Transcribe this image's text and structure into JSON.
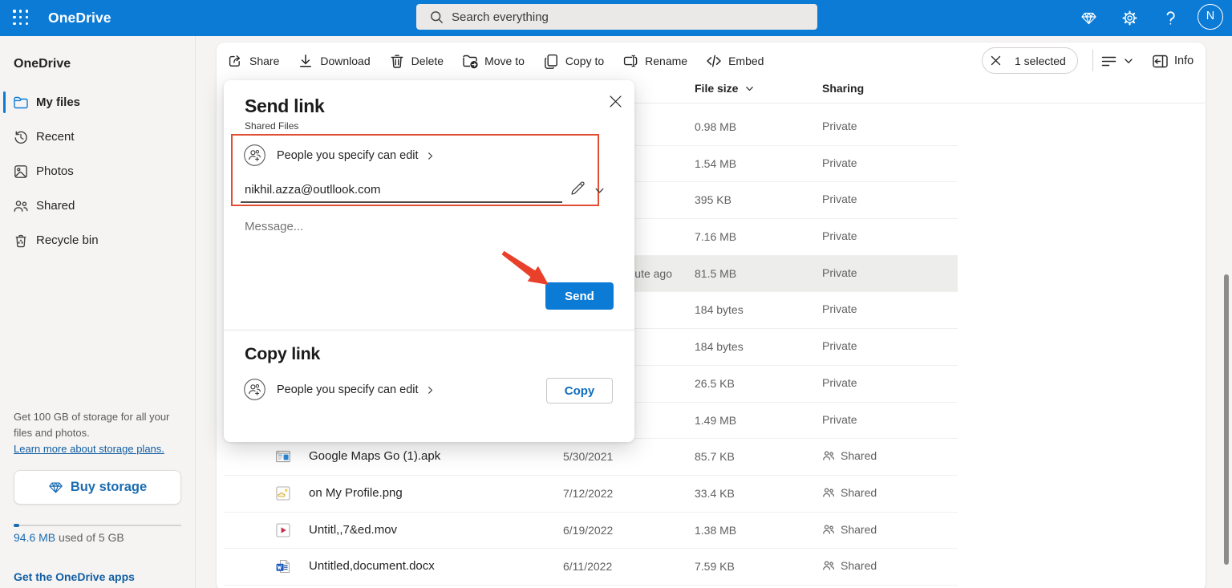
{
  "header": {
    "app_title": "OneDrive",
    "search_placeholder": "Search everything",
    "avatar_initial": "N",
    "icons": [
      "waffle-icon",
      "premium-diamond-icon",
      "settings-gear-icon",
      "help-icon"
    ]
  },
  "sidebar": {
    "title": "OneDrive",
    "items": [
      {
        "label": "My files",
        "icon": "folder-icon",
        "selected": true
      },
      {
        "label": "Recent",
        "icon": "history-icon",
        "selected": false
      },
      {
        "label": "Photos",
        "icon": "image-icon",
        "selected": false
      },
      {
        "label": "Shared",
        "icon": "people-icon",
        "selected": false
      },
      {
        "label": "Recycle bin",
        "icon": "recycle-bin-icon",
        "selected": false
      }
    ],
    "promo_line1": "Get 100 GB of storage for all your",
    "promo_line2": "files and photos.",
    "promo_link": "Learn more about storage plans.",
    "buy_button_label": "Buy storage",
    "usage_amount": "94.6 MB",
    "usage_rest": " used of 5 GB",
    "apps_link": "Get the OneDrive apps"
  },
  "toolbar": {
    "actions": [
      {
        "label": "Share",
        "icon": "share-icon"
      },
      {
        "label": "Download",
        "icon": "download-icon"
      },
      {
        "label": "Delete",
        "icon": "delete-icon"
      },
      {
        "label": "Move to",
        "icon": "move-to-icon"
      },
      {
        "label": "Copy to",
        "icon": "copy-to-icon"
      },
      {
        "label": "Rename",
        "icon": "rename-icon"
      },
      {
        "label": "Embed",
        "icon": "embed-icon"
      }
    ],
    "selected_count": "1 selected",
    "view_menu_icon": "view-options-icon",
    "info_label": "Info"
  },
  "table": {
    "header_file_size": "File size",
    "header_sharing": "Sharing",
    "rows": [
      {
        "name": "",
        "modified": "",
        "size": "0.98 MB",
        "sharing": "Private",
        "icon": "",
        "highlighted": false
      },
      {
        "name": "",
        "modified": "",
        "size": "1.54 MB",
        "sharing": "Private",
        "icon": "",
        "highlighted": false
      },
      {
        "name": "",
        "modified": "",
        "size": "395 KB",
        "sharing": "Private",
        "icon": "",
        "highlighted": false
      },
      {
        "name": "",
        "modified": "",
        "size": "7.16 MB",
        "sharing": "Private",
        "icon": "",
        "highlighted": false
      },
      {
        "name": "",
        "modified": "About a minute ago",
        "size": "81.5 MB",
        "sharing": "Private",
        "icon": "",
        "highlighted": true
      },
      {
        "name": "",
        "modified": "",
        "size": "184 bytes",
        "sharing": "Private",
        "icon": "",
        "highlighted": false
      },
      {
        "name": "",
        "modified": "",
        "size": "184 bytes",
        "sharing": "Private",
        "icon": "",
        "highlighted": false
      },
      {
        "name": "",
        "modified": "",
        "size": "26.5 KB",
        "sharing": "Private",
        "icon": "",
        "highlighted": false
      },
      {
        "name": "",
        "modified": "",
        "size": "1.49 MB",
        "sharing": "Private",
        "icon": "",
        "highlighted": false
      },
      {
        "name": "Google Maps Go (1).apk",
        "modified": "5/30/2021",
        "size": "85.7 KB",
        "sharing": "Shared",
        "icon": "apk-file-icon",
        "highlighted": false
      },
      {
        "name": "on My Profile.png",
        "modified": "7/12/2022",
        "size": "33.4 KB",
        "sharing": "Shared",
        "icon": "image-file-icon",
        "highlighted": false
      },
      {
        "name": "Untitl,,7&ed.mov",
        "modified": "6/19/2022",
        "size": "1.38 MB",
        "sharing": "Shared",
        "icon": "video-file-icon",
        "highlighted": false
      },
      {
        "name": "Untitled,document.docx",
        "modified": "6/11/2022",
        "size": "7.59 KB",
        "sharing": "Shared",
        "icon": "word-file-icon",
        "highlighted": false
      }
    ]
  },
  "dialog": {
    "title": "Send link",
    "subtitle": "Shared Files",
    "permission_label": "People you specify can edit",
    "email_value": "nikhil.azza@outllook.com",
    "message_placeholder": "Message...",
    "send_label": "Send",
    "copy_title": "Copy link",
    "copy_permission_label": "People you specify can edit",
    "copy_button_label": "Copy"
  },
  "colors": {
    "header_blue": "#0C7BD6",
    "accent_blue": "#0C7BD6",
    "link_blue": "#115EA3",
    "copy_text_blue": "#0F6CBD",
    "annotation_red": "#E8452F",
    "row_highlight": "#EDEDEC"
  }
}
